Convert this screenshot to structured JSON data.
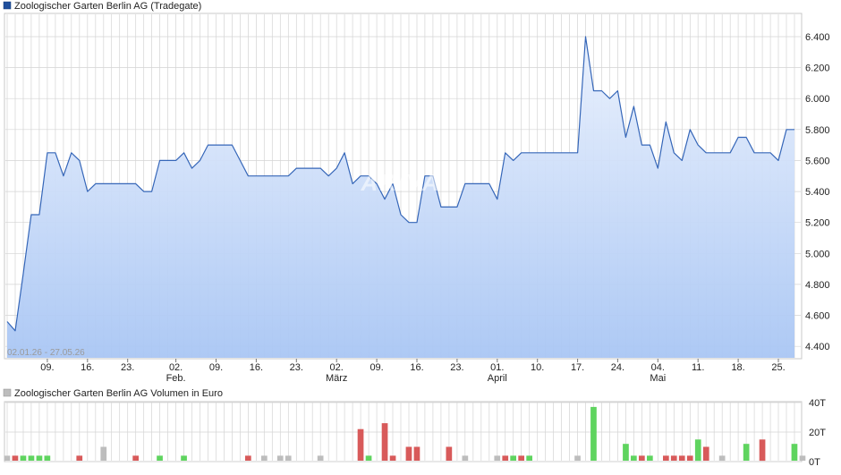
{
  "chart_data": [
    {
      "type": "area",
      "title": "Zoologischer Garten Berlin AG (Tradegate)",
      "date_range": "02.01.26 - 27.05.26",
      "watermark": "ARIVA",
      "colors": {
        "line": "#3566b8",
        "fill_top": "#eaf1fd",
        "fill_bottom": "#a9c6f4",
        "legend": "#1f4f9c",
        "grid": "#d4d4d4"
      },
      "grid": true,
      "ylim": [
        4.32,
        6.55
      ],
      "y_ticks": [
        "6.400",
        "6.200",
        "6.000",
        "5.800",
        "5.600",
        "5.400",
        "5.200",
        "5.000",
        "4.800",
        "4.600",
        "4.400"
      ],
      "x_ticks": [
        {
          "index": 5,
          "label": "09."
        },
        {
          "index": 10,
          "label": "16."
        },
        {
          "index": 15,
          "label": "23."
        },
        {
          "index": 21,
          "label": "02.",
          "sub": "Feb."
        },
        {
          "index": 26,
          "label": "09."
        },
        {
          "index": 31,
          "label": "16."
        },
        {
          "index": 36,
          "label": "23."
        },
        {
          "index": 41,
          "label": "02.",
          "sub": "März"
        },
        {
          "index": 46,
          "label": "09."
        },
        {
          "index": 51,
          "label": "16."
        },
        {
          "index": 56,
          "label": "23."
        },
        {
          "index": 61,
          "label": "01.",
          "sub": "April"
        },
        {
          "index": 66,
          "label": "10."
        },
        {
          "index": 71,
          "label": "17."
        },
        {
          "index": 76,
          "label": "24."
        },
        {
          "index": 81,
          "label": "04.",
          "sub": "Mai"
        },
        {
          "index": 86,
          "label": "11."
        },
        {
          "index": 91,
          "label": "18."
        },
        {
          "index": 96,
          "label": "25."
        }
      ],
      "values": [
        4.56,
        4.5,
        4.87,
        5.25,
        5.25,
        5.65,
        5.65,
        5.5,
        5.65,
        5.6,
        5.4,
        5.45,
        5.45,
        5.45,
        5.45,
        5.45,
        5.45,
        5.4,
        5.4,
        5.6,
        5.6,
        5.6,
        5.65,
        5.55,
        5.6,
        5.7,
        5.7,
        5.7,
        5.7,
        5.6,
        5.5,
        5.5,
        5.5,
        5.5,
        5.5,
        5.5,
        5.55,
        5.55,
        5.55,
        5.55,
        5.5,
        5.55,
        5.65,
        5.45,
        5.5,
        5.5,
        5.45,
        5.35,
        5.45,
        5.25,
        5.2,
        5.2,
        5.5,
        5.5,
        5.3,
        5.3,
        5.3,
        5.45,
        5.45,
        5.45,
        5.45,
        5.35,
        5.65,
        5.6,
        5.65,
        5.65,
        5.65,
        5.65,
        5.65,
        5.65,
        5.65,
        5.65,
        6.4,
        6.05,
        6.05,
        6.0,
        6.05,
        5.75,
        5.95,
        5.7,
        5.7,
        5.55,
        5.85,
        5.65,
        5.6,
        5.8,
        5.7,
        5.65,
        5.65,
        5.65,
        5.65,
        5.75,
        5.75,
        5.65,
        5.65,
        5.65,
        5.6,
        5.8,
        5.8
      ]
    },
    {
      "type": "bar",
      "title": "Zoologischer Garten Berlin AG Volumen in Euro",
      "colors": {
        "up": "#5fd45f",
        "down": "#d85a5a",
        "neutral": "#bdbdbd",
        "legend": "#bdbdbd"
      },
      "ylim": [
        0,
        40
      ],
      "y_ticks": [
        "40T",
        "20T",
        "0T"
      ],
      "bars": [
        {
          "i": 0,
          "v": 4,
          "c": "neutral"
        },
        {
          "i": 1,
          "v": 4,
          "c": "down"
        },
        {
          "i": 2,
          "v": 4,
          "c": "up"
        },
        {
          "i": 3,
          "v": 4,
          "c": "up"
        },
        {
          "i": 4,
          "v": 4,
          "c": "up"
        },
        {
          "i": 5,
          "v": 4,
          "c": "up"
        },
        {
          "i": 9,
          "v": 4,
          "c": "down"
        },
        {
          "i": 12,
          "v": 10,
          "c": "neutral"
        },
        {
          "i": 16,
          "v": 4,
          "c": "down"
        },
        {
          "i": 19,
          "v": 4,
          "c": "up"
        },
        {
          "i": 22,
          "v": 4,
          "c": "up"
        },
        {
          "i": 30,
          "v": 4,
          "c": "down"
        },
        {
          "i": 32,
          "v": 4,
          "c": "neutral"
        },
        {
          "i": 34,
          "v": 4,
          "c": "neutral"
        },
        {
          "i": 35,
          "v": 4,
          "c": "neutral"
        },
        {
          "i": 39,
          "v": 4,
          "c": "neutral"
        },
        {
          "i": 44,
          "v": 22,
          "c": "down"
        },
        {
          "i": 45,
          "v": 4,
          "c": "up"
        },
        {
          "i": 47,
          "v": 26,
          "c": "down"
        },
        {
          "i": 48,
          "v": 4,
          "c": "down"
        },
        {
          "i": 50,
          "v": 10,
          "c": "down"
        },
        {
          "i": 51,
          "v": 10,
          "c": "down"
        },
        {
          "i": 55,
          "v": 10,
          "c": "down"
        },
        {
          "i": 57,
          "v": 4,
          "c": "neutral"
        },
        {
          "i": 61,
          "v": 4,
          "c": "neutral"
        },
        {
          "i": 62,
          "v": 4,
          "c": "down"
        },
        {
          "i": 63,
          "v": 4,
          "c": "up"
        },
        {
          "i": 64,
          "v": 4,
          "c": "down"
        },
        {
          "i": 65,
          "v": 4,
          "c": "up"
        },
        {
          "i": 71,
          "v": 4,
          "c": "neutral"
        },
        {
          "i": 73,
          "v": 37,
          "c": "up"
        },
        {
          "i": 77,
          "v": 12,
          "c": "up"
        },
        {
          "i": 78,
          "v": 4,
          "c": "up"
        },
        {
          "i": 79,
          "v": 4,
          "c": "down"
        },
        {
          "i": 80,
          "v": 4,
          "c": "up"
        },
        {
          "i": 82,
          "v": 4,
          "c": "down"
        },
        {
          "i": 83,
          "v": 4,
          "c": "down"
        },
        {
          "i": 84,
          "v": 4,
          "c": "down"
        },
        {
          "i": 85,
          "v": 4,
          "c": "down"
        },
        {
          "i": 86,
          "v": 15,
          "c": "up"
        },
        {
          "i": 87,
          "v": 10,
          "c": "down"
        },
        {
          "i": 89,
          "v": 4,
          "c": "neutral"
        },
        {
          "i": 92,
          "v": 12,
          "c": "up"
        },
        {
          "i": 94,
          "v": 15,
          "c": "down"
        },
        {
          "i": 98,
          "v": 12,
          "c": "up"
        },
        {
          "i": 99,
          "v": 4,
          "c": "neutral"
        }
      ]
    }
  ]
}
